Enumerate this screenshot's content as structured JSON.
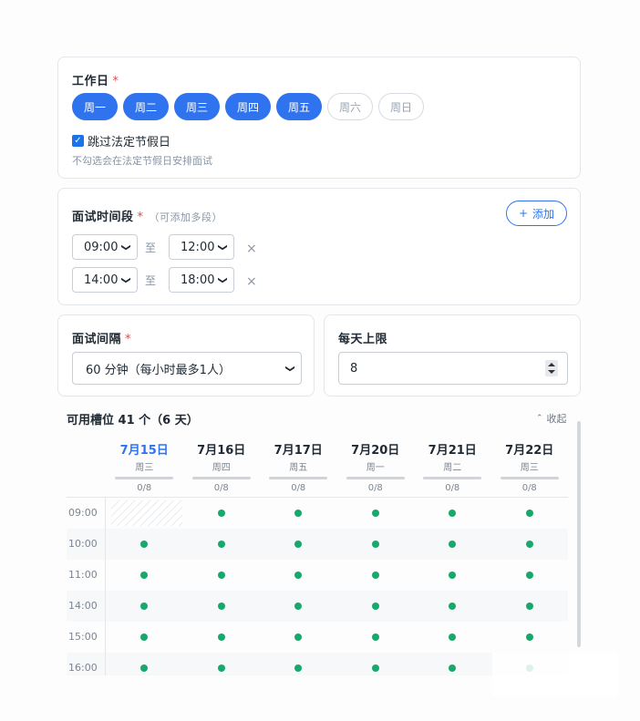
{
  "workdays": {
    "label": "工作日",
    "required_mark": "*",
    "days": [
      {
        "label": "周一",
        "selected": true
      },
      {
        "label": "周二",
        "selected": true
      },
      {
        "label": "周三",
        "selected": true
      },
      {
        "label": "周四",
        "selected": true
      },
      {
        "label": "周五",
        "selected": true
      },
      {
        "label": "周六",
        "selected": false
      },
      {
        "label": "周日",
        "selected": false
      }
    ],
    "skip_holidays_label": "跳过法定节假日",
    "skip_holidays_checked": true,
    "skip_holidays_hint": "不勾选会在法定节假日安排面试"
  },
  "time_ranges": {
    "label": "面试时间段",
    "required_mark": "*",
    "hint": "（可添加多段）",
    "add_label": "添加",
    "add_icon": "plus-icon",
    "to_label": "至",
    "delete_icon": "×",
    "ranges": [
      {
        "start": "09:00",
        "end": "12:00"
      },
      {
        "start": "14:00",
        "end": "18:00"
      }
    ]
  },
  "interval": {
    "label": "面试间隔",
    "required_mark": "*",
    "value": "60 分钟（每小时最多1人）"
  },
  "daily_limit": {
    "label": "每天上限",
    "value": "8"
  },
  "slots": {
    "title": "可用槽位 41 个（6 天）",
    "collapse_label": "收起",
    "collapse_icon": "chevron-up-icon",
    "accent_color": "#2f74ee",
    "available_color": "#18a86b",
    "days": [
      {
        "date": "7月15日",
        "weekday": "周三",
        "count": "0/8",
        "today": true
      },
      {
        "date": "7月16日",
        "weekday": "周四",
        "count": "0/8",
        "today": false
      },
      {
        "date": "7月17日",
        "weekday": "周五",
        "count": "0/8",
        "today": false
      },
      {
        "date": "7月20日",
        "weekday": "周一",
        "count": "0/8",
        "today": false
      },
      {
        "date": "7月21日",
        "weekday": "周二",
        "count": "0/8",
        "today": false
      },
      {
        "date": "7月22日",
        "weekday": "周三",
        "count": "0/8",
        "today": false
      }
    ],
    "rows": [
      {
        "time": "09:00",
        "cells": [
          "past",
          "available",
          "available",
          "available",
          "available",
          "available"
        ]
      },
      {
        "time": "10:00",
        "cells": [
          "available",
          "available",
          "available",
          "available",
          "available",
          "available"
        ]
      },
      {
        "time": "11:00",
        "cells": [
          "available",
          "available",
          "available",
          "available",
          "available",
          "available"
        ]
      },
      {
        "time": "14:00",
        "cells": [
          "available",
          "available",
          "available",
          "available",
          "available",
          "available"
        ]
      },
      {
        "time": "15:00",
        "cells": [
          "available",
          "available",
          "available",
          "available",
          "available",
          "available"
        ]
      },
      {
        "time": "16:00",
        "cells": [
          "available",
          "available",
          "available",
          "available",
          "available",
          "available"
        ]
      }
    ]
  }
}
